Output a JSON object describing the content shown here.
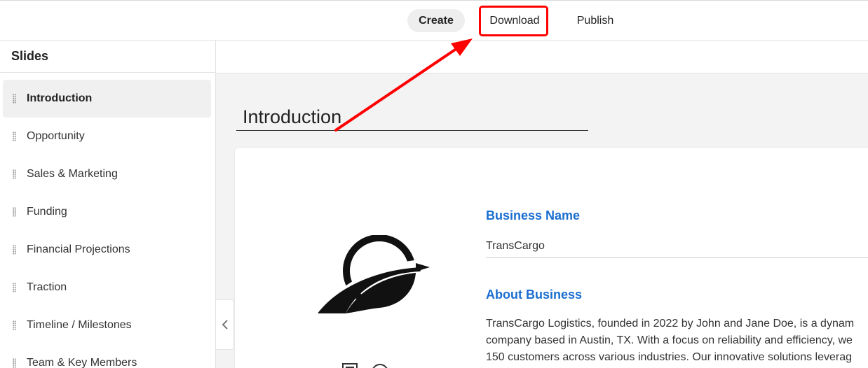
{
  "topbar": {
    "tabs": [
      {
        "label": "Create",
        "active": true
      },
      {
        "label": "Download",
        "active": false
      },
      {
        "label": "Publish",
        "active": false
      }
    ]
  },
  "sidebar": {
    "header": "Slides",
    "items": [
      {
        "label": "Introduction",
        "active": true
      },
      {
        "label": "Opportunity"
      },
      {
        "label": "Sales & Marketing"
      },
      {
        "label": "Funding"
      },
      {
        "label": "Financial Projections"
      },
      {
        "label": "Traction"
      },
      {
        "label": "Timeline / Milestones"
      },
      {
        "label": "Team & Key Members"
      }
    ]
  },
  "main": {
    "slide_title": "Introduction",
    "collapse_icon": "chevron-left-icon",
    "card": {
      "logo_icon": "transcargo-logo",
      "business_name_label": "Business Name",
      "business_name_value": "TransCargo",
      "about_label": "About Business",
      "about_lines": [
        "TransCargo Logistics, founded in 2022 by John and Jane Doe, is a dynam",
        "company based in Austin, TX. With a focus on reliability and efficiency, we",
        "150 customers across various industries. Our innovative solutions leverag"
      ]
    }
  },
  "colors": {
    "accent_blue": "#1a6ed0",
    "annotation_red": "#ff0000",
    "active_tab_bg": "#eeeeee"
  }
}
